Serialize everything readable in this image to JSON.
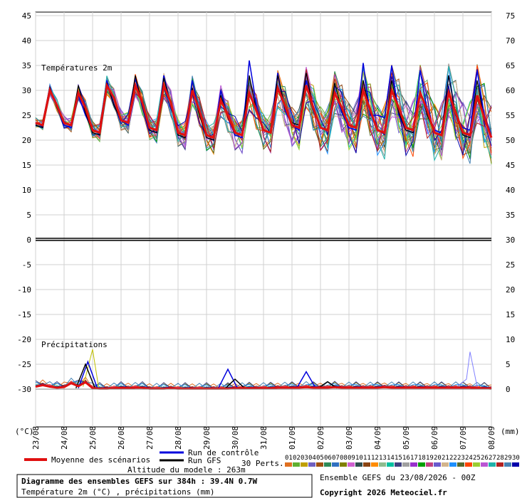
{
  "chart_data": {
    "type": "line",
    "title": "Diagramme des ensembles GEFS sur 384h : 39.4N 0.7W",
    "subtitle": "Température 2m (°C) , précipitations (mm)",
    "panels": {
      "temperature_label": "Températures 2m",
      "precipitation_label": "Précipitations"
    },
    "left_axis": {
      "unit": "(°C)",
      "ylim": [
        -38,
        48
      ],
      "ticks": [
        45,
        40,
        35,
        30,
        25,
        20,
        15,
        10,
        5,
        0,
        -5,
        -10,
        -15,
        -20,
        -25,
        -30
      ]
    },
    "right_axis": {
      "unit": "(mm)",
      "ticks": [
        75,
        70,
        65,
        60,
        55,
        50,
        45,
        40,
        35,
        30,
        25,
        20,
        15,
        10,
        5,
        0
      ],
      "precip_ticks": [
        10,
        5,
        0
      ]
    },
    "x_axis": {
      "range_hours": [
        0,
        384
      ],
      "dates": [
        "23/08",
        "24/08",
        "25/08",
        "26/08",
        "27/08",
        "28/08",
        "29/08",
        "30/08",
        "31/08",
        "01/09",
        "02/09",
        "03/09",
        "04/09",
        "05/09",
        "06/09",
        "07/09",
        "08/09"
      ]
    },
    "mean_temperature": {
      "name": "Moyenne des scénarios",
      "color": "#e01010",
      "hours": [
        0,
        6,
        12,
        18,
        24,
        30,
        36,
        42,
        48,
        54,
        60,
        66,
        72,
        78,
        84,
        90,
        96,
        102,
        108,
        114,
        120,
        126,
        132,
        138,
        144,
        150,
        156,
        162,
        168,
        174,
        180,
        186,
        192,
        198,
        204,
        210,
        216,
        222,
        228,
        234,
        240,
        246,
        252,
        258,
        264,
        270,
        276,
        282,
        288,
        294,
        300,
        306,
        312,
        318,
        324,
        330,
        336,
        342,
        348,
        354,
        360,
        366,
        372,
        378,
        384
      ],
      "values": [
        23.5,
        23,
        30,
        27,
        23.5,
        23,
        29.5,
        26.5,
        22,
        21.5,
        31,
        28.5,
        24,
        23.5,
        31,
        27.5,
        22.5,
        22,
        31,
        27.5,
        21.5,
        21,
        30,
        26,
        21,
        20.5,
        28,
        25,
        21.5,
        21,
        29.5,
        26,
        22,
        21.5,
        30.5,
        27,
        23,
        22.5,
        31,
        26.5,
        22.5,
        22,
        29.5,
        26.5,
        23,
        22.5,
        30,
        26,
        22,
        21.5,
        30,
        26.5,
        22.5,
        22,
        29.5,
        26,
        21.5,
        21,
        29.5,
        25.5,
        21.5,
        21,
        29,
        24.5,
        20.5
      ]
    },
    "mean_precipitation": {
      "name": "Moyenne des scénarios",
      "hours": [
        0,
        6,
        12,
        18,
        24,
        30,
        36,
        42,
        48,
        54,
        60,
        66,
        72,
        78,
        84,
        90,
        96,
        102,
        108,
        114,
        120,
        126,
        132,
        138,
        144,
        150,
        156,
        162,
        168,
        174,
        180,
        186,
        192,
        198,
        204,
        210,
        216,
        222,
        228,
        234,
        240,
        246,
        252,
        258,
        264,
        270,
        276,
        282,
        288,
        294,
        300,
        306,
        312,
        318,
        324,
        330,
        336,
        342,
        348,
        354,
        360,
        366,
        372,
        378,
        384
      ],
      "values": [
        0.5,
        0.8,
        0.5,
        0.3,
        0.4,
        1.2,
        0.6,
        1.4,
        0.2,
        0.1,
        0.1,
        0.2,
        0.3,
        0.2,
        0.3,
        0.3,
        0.1,
        0.1,
        0.1,
        0.2,
        0.1,
        0.1,
        0.1,
        0.1,
        0.1,
        0.1,
        0.1,
        0.1,
        0.2,
        0.2,
        0.2,
        0.2,
        0.2,
        0.2,
        0.3,
        0.3,
        0.3,
        0.3,
        0.4,
        0.3,
        0.3,
        0.3,
        0.4,
        0.3,
        0.3,
        0.3,
        0.3,
        0.3,
        0.3,
        0.4,
        0.3,
        0.3,
        0.3,
        0.3,
        0.3,
        0.3,
        0.3,
        0.3,
        0.3,
        0.3,
        0.3,
        0.3,
        0.2,
        0.2,
        0.1
      ]
    },
    "control_run": {
      "name": "Run de contrôle",
      "color": "#0000dd",
      "values": [
        23,
        22.5,
        30.5,
        26.5,
        23,
        22.5,
        29,
        25,
        22,
        21.5,
        32,
        27,
        24,
        23,
        32.5,
        27,
        22,
        21.5,
        33,
        27,
        21,
        20.5,
        32,
        25.5,
        20.5,
        20,
        30,
        24.5,
        21,
        20.5,
        36,
        27,
        22,
        21.5,
        33.5,
        26,
        23,
        22,
        32,
        26,
        22.5,
        22,
        30,
        25.5,
        22.5,
        22,
        35.5,
        25,
        25,
        24.5,
        35,
        25,
        22,
        21.5,
        34,
        26,
        22,
        21.5,
        33,
        25,
        22.5,
        22,
        34,
        25,
        21
      ]
    },
    "gfs_run": {
      "name": "Run GFS",
      "color": "#000000",
      "values": [
        23,
        22.5,
        30.5,
        26.5,
        23.5,
        23,
        31,
        25.5,
        21.5,
        21,
        31.5,
        27,
        24,
        23.5,
        33,
        27,
        22,
        21.5,
        32.5,
        27,
        21,
        20.5,
        30.5,
        25,
        20.5,
        20,
        29,
        24.5,
        21.5,
        21,
        33,
        26,
        22,
        21.5,
        33,
        26.5,
        23.5,
        23,
        33.5,
        26,
        22.5,
        22,
        31.5,
        26,
        23,
        22.5,
        32,
        25.5,
        22,
        21.5,
        32,
        25.5,
        22,
        21.5,
        30,
        25,
        21.5,
        21,
        33,
        25,
        21,
        20.5,
        32,
        24,
        20.5
      ]
    },
    "control_precip_peaks": [
      [
        44,
        5.5
      ],
      [
        162,
        4
      ],
      [
        228,
        3.5
      ]
    ],
    "gfs_precip_peaks": [
      [
        42,
        5
      ],
      [
        168,
        2
      ],
      [
        246,
        1.5
      ]
    ],
    "perturbations": {
      "count": 30,
      "label": "30 Perts.",
      "ids": [
        "01",
        "02",
        "03",
        "04",
        "05",
        "06",
        "07",
        "08",
        "09",
        "10",
        "11",
        "12",
        "13",
        "14",
        "15",
        "16",
        "17",
        "18",
        "19",
        "20",
        "21",
        "22",
        "23",
        "24",
        "25",
        "26",
        "27",
        "28",
        "29",
        "30"
      ],
      "colors": [
        "#e07020",
        "#60b030",
        "#c0a000",
        "#7060c0",
        "#a05010",
        "#2e8b57",
        "#3070c0",
        "#808000",
        "#d060d0",
        "#2f4f4f",
        "#8b4513",
        "#ff8c00",
        "#8fbc8f",
        "#00c0a0",
        "#404080",
        "#a0a0a0",
        "#9932cc",
        "#00a000",
        "#c04080",
        "#6a5acd",
        "#d2b48c",
        "#1e90ff",
        "#556b2f",
        "#ff4500",
        "#9acd32",
        "#ba55d3",
        "#20b2aa",
        "#b22222",
        "#4682b4",
        "#0000aa"
      ],
      "temperature_spread_max": [
        37,
        37,
        37,
        37,
        37,
        37,
        37,
        37,
        37,
        37,
        37,
        37,
        37,
        37,
        37,
        37,
        37,
        37,
        37,
        37,
        37,
        37,
        37,
        37,
        37,
        37,
        37,
        37,
        37,
        37,
        37
      ],
      "max_precip_peak": [
        [
          366,
          7.5
        ],
        [
          48,
          8
        ]
      ]
    },
    "legend": {
      "mean": "Moyenne des scénarios",
      "control": "Run de contrôle",
      "gfs": "Run GFS"
    },
    "footer": {
      "altitude": "Altitude du modele : 263m",
      "run_info": "Ensemble GEFS du 23/08/2026 - 00Z",
      "copyright": "Copyright 2026 Meteociel.fr"
    }
  }
}
